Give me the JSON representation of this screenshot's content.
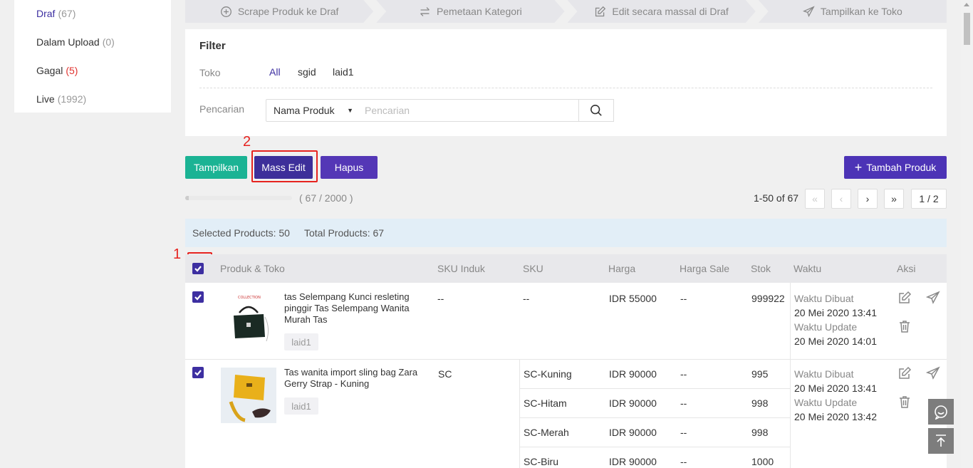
{
  "sidebar": {
    "items": [
      {
        "label": "Draf",
        "count": "(67)"
      },
      {
        "label": "Dalam Upload",
        "count": "(0)"
      },
      {
        "label": "Gagal",
        "count": "(5)"
      },
      {
        "label": "Live",
        "count": "(1992)"
      }
    ]
  },
  "steps": [
    {
      "label": "Scrape Produk ke Draf",
      "icon": "plus-circle-icon"
    },
    {
      "label": "Pemetaan Kategori",
      "icon": "swap-arrows-icon"
    },
    {
      "label": "Edit secara massal di Draf",
      "icon": "edit-icon"
    },
    {
      "label": "Tampilkan ke Toko",
      "icon": "send-icon"
    }
  ],
  "filter": {
    "title": "Filter",
    "toko_label": "Toko",
    "toko_options": [
      "All",
      "sgid",
      "laid1"
    ],
    "search_label": "Pencarian",
    "search_field": "Nama Produk",
    "search_placeholder": "Pencarian"
  },
  "actions": {
    "tampilkan": "Tampilkan",
    "mass_edit": "Mass Edit",
    "hapus": "Hapus",
    "tambah": "Tambah Produk"
  },
  "annotations": {
    "one": "1",
    "two": "2"
  },
  "progress": {
    "text": "( 67 / 2000 )",
    "fraction": 0.0335
  },
  "pagination": {
    "info": "1-50 of 67",
    "first": "«",
    "prev": "‹",
    "next": "›",
    "last": "»",
    "page": "1 / 2"
  },
  "summary": {
    "selected": "Selected Products: 50",
    "total": "Total Products: 67"
  },
  "table": {
    "headers": [
      "Produk & Toko",
      "SKU Induk",
      "SKU",
      "Harga",
      "Harga Sale",
      "Stok",
      "Waktu",
      "Aksi"
    ],
    "rows": [
      {
        "name": "tas Selempang Kunci resleting pinggir Tas Selempang Wanita Murah Tas",
        "store": "laid1",
        "sku_induk": "--",
        "variants": [
          {
            "sku": "--",
            "harga": "IDR 55000",
            "sale": "--",
            "stok": "999922"
          }
        ],
        "created_label": "Waktu Dibuat",
        "created": "20 Mei 2020 13:41",
        "updated_label": "Waktu Update",
        "updated": "20 Mei 2020 14:01"
      },
      {
        "name": "Tas wanita import sling bag Zara Gerry Strap - Kuning",
        "store": "laid1",
        "sku_induk": "SC",
        "variants": [
          {
            "sku": "SC-Kuning",
            "harga": "IDR 90000",
            "sale": "--",
            "stok": "995"
          },
          {
            "sku": "SC-Hitam",
            "harga": "IDR 90000",
            "sale": "--",
            "stok": "998"
          },
          {
            "sku": "SC-Merah",
            "harga": "IDR 90000",
            "sale": "--",
            "stok": "998"
          },
          {
            "sku": "SC-Biru",
            "harga": "IDR 90000",
            "sale": "--",
            "stok": "1000"
          }
        ],
        "created_label": "Waktu Dibuat",
        "created": "20 Mei 2020 13:41",
        "updated_label": "Waktu Update",
        "updated": "20 Mei 2020 13:42"
      }
    ]
  },
  "colors": {
    "brand_purple": "#3d2fa1",
    "green": "#1bb394",
    "annotation_red": "#e6231f"
  }
}
